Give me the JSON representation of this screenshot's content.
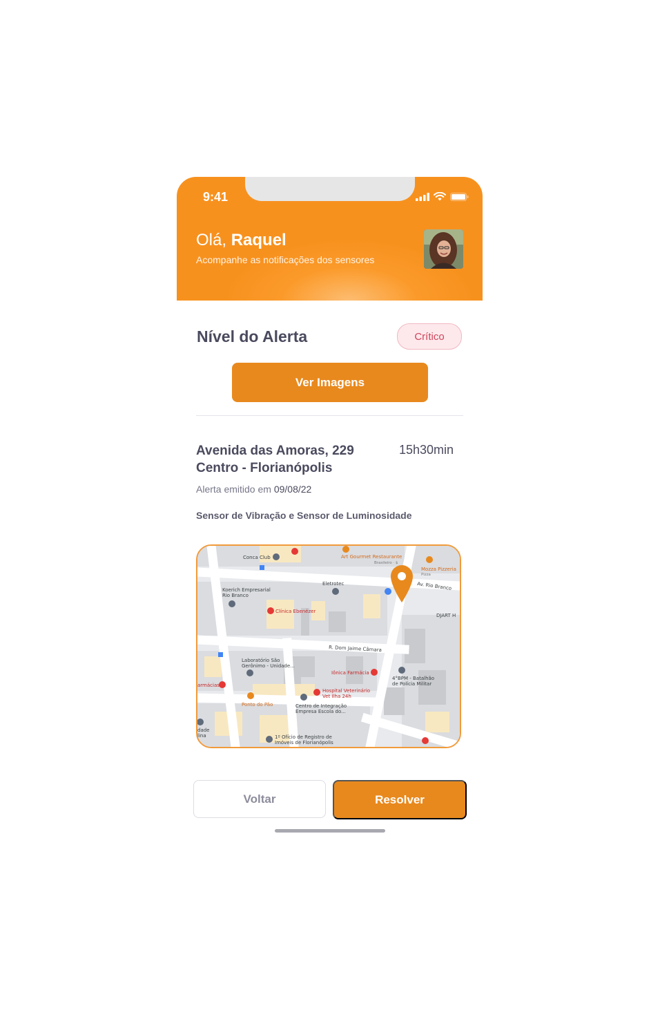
{
  "status_bar": {
    "time": "9:41"
  },
  "header": {
    "greeting_prefix": "Olá, ",
    "user_name": "Raquel",
    "subtitle": "Acompanhe as notificações dos sensores"
  },
  "alert": {
    "level_label": "Nível do Alerta",
    "level_value": "Crítico",
    "level_color": "#d0455b",
    "view_images_label": "Ver Imagens",
    "address_line1": "Avenida das Amoras, 229",
    "address_line2": "Centro - Florianópolis",
    "time": "15h30min",
    "emitted_prefix": "Alerta emitido em",
    "emitted_date": "09/08/22",
    "sensors": "Sensor de Vibração e Sensor de Luminosidade"
  },
  "map": {
    "labels": {
      "conca_club": "Conca Club",
      "art_gourmet": "Art Gourmet Restaurante",
      "art_gourmet_sub": "Brasileiro · $",
      "mozza": "Mozza Pizzeria",
      "mozza_sub": "Pizza",
      "av_rio_branco": "Av. Rio Branco",
      "eletrotec": "Eletrotec",
      "koerich": "Koerich Empresarial",
      "koerich2": "Rio Branco",
      "clinica": "Clínica Ebenézer",
      "djart": "DJART H",
      "dom_jaime": "R. Dom Jaime Câmara",
      "laboratorio": "Laboratório São",
      "laboratorio2": "Gerônimo - Unidade...",
      "ionica": "Iônica Farmácia",
      "bpm": "4°BPM - Batalhão",
      "bpm2": "de Polícia Militar",
      "farmacias": "armácias",
      "hospital": "Hospital Veterinário",
      "hospital2": "Vet Ilha 24h",
      "ponto": "Ponto do Pão",
      "centro_int": "Centro de Integração",
      "centro_int2": "Empresa Escola do...",
      "dade": "dade",
      "dade2": "lina",
      "oficio": "1º Ofício de Registro de",
      "oficio2": "Imóveis de Florianópolis"
    }
  },
  "actions": {
    "back_label": "Voltar",
    "resolve_label": "Resolver"
  },
  "colors": {
    "primary": "#e8891e",
    "header": "#fb9a2a",
    "critical_bg": "#fde9ec"
  }
}
